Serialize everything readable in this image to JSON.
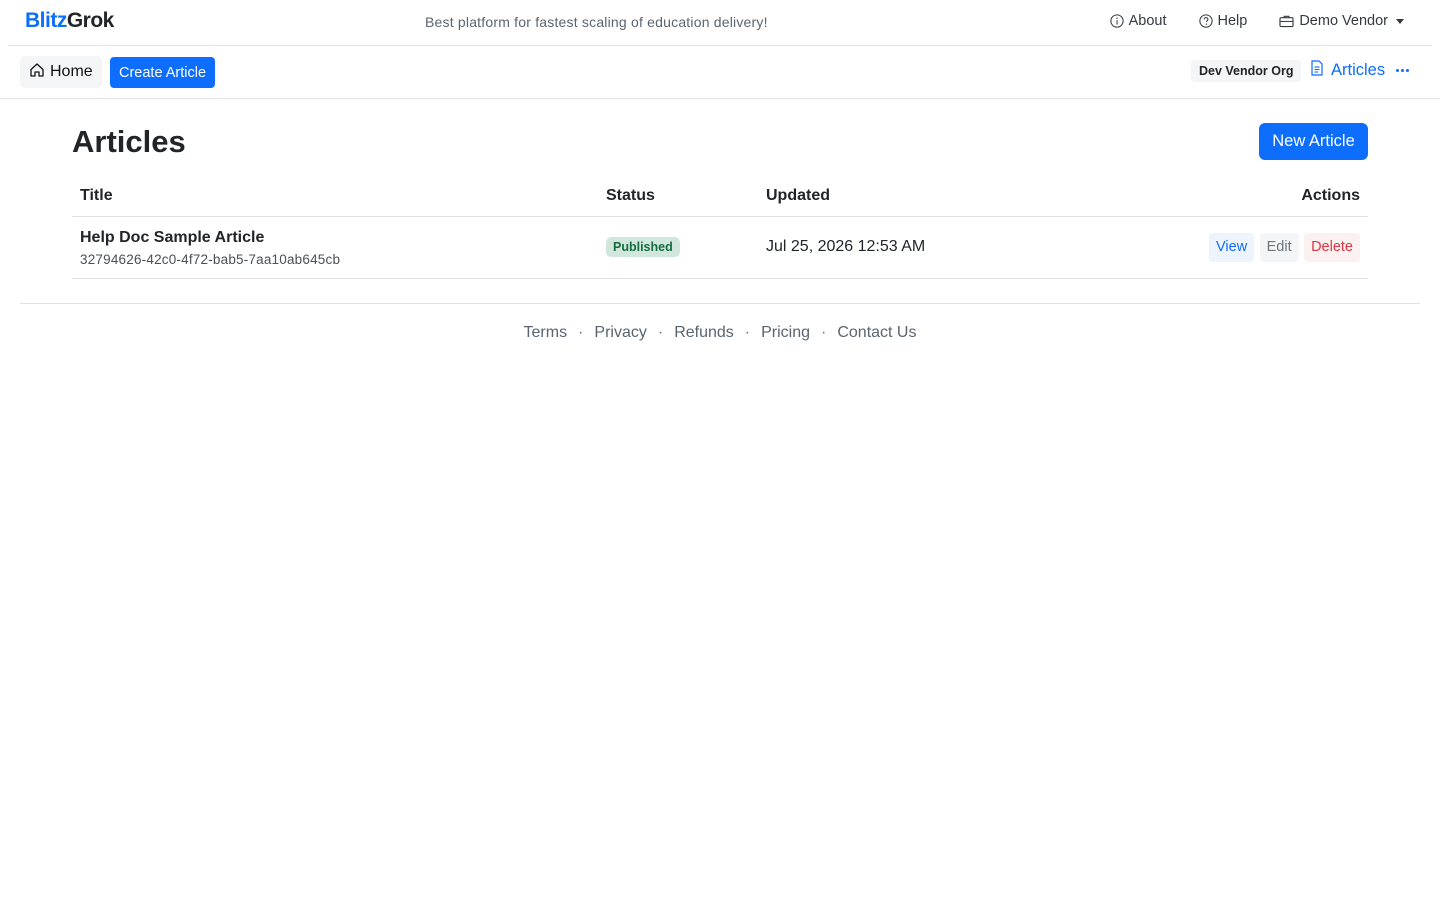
{
  "brand": {
    "part1": "Blitz",
    "part2": "Grok",
    "color": "#0d6efd"
  },
  "tagline": "Best platform for fastest scaling of education delivery!",
  "topnav": {
    "about": "About",
    "help": "Help",
    "vendor": "Demo Vendor"
  },
  "toolbar": {
    "home": "Home",
    "create_article": "Create Article",
    "org": "Dev Vendor Org",
    "articles": "Articles"
  },
  "main": {
    "title": "Articles",
    "new_article": "New Article",
    "columns": {
      "title": "Title",
      "status": "Status",
      "updated": "Updated",
      "actions": "Actions"
    },
    "rows": [
      {
        "title": "Help Doc Sample Article",
        "id": "32794626-42c0-4f72-bab5-7aa10ab645cb",
        "status": "Published",
        "updated": "Jul 25, 2026 12:53 AM",
        "actions": {
          "view": "View",
          "edit": "Edit",
          "delete": "Delete"
        }
      }
    ]
  },
  "footer": {
    "links": [
      "Terms",
      "Privacy",
      "Refunds",
      "Pricing",
      "Contact Us"
    ],
    "separator": "·"
  },
  "colors": {
    "primary": "#0d6efd",
    "success_bg": "#d1e7dd",
    "success_text": "#146c43",
    "danger": "#dc3545"
  }
}
